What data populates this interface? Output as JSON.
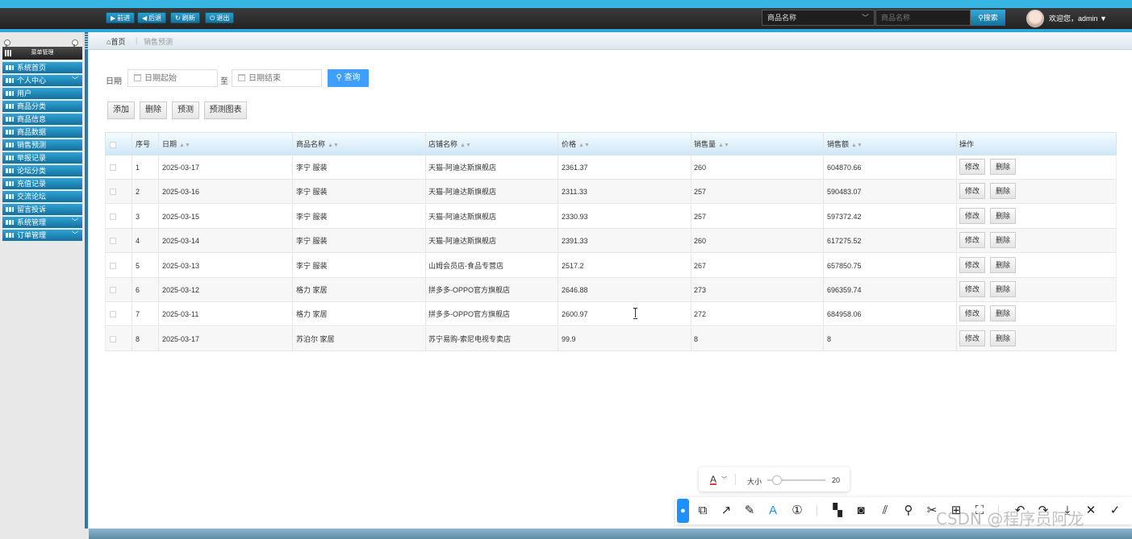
{
  "header": {
    "nav_buttons": [
      {
        "icon": "play-icon",
        "glyph": "▶",
        "label": "前进"
      },
      {
        "icon": "back-icon",
        "glyph": "◀",
        "label": "后退"
      },
      {
        "icon": "refresh-icon",
        "glyph": "↻",
        "label": "刷新"
      },
      {
        "icon": "power-icon",
        "glyph": "⏻",
        "label": "退出"
      }
    ],
    "search_field_select": "商品名称",
    "search_placeholder": "商品名称",
    "search_button": "搜索",
    "welcome": "欢迎您，admin"
  },
  "sidebar": {
    "title": "菜单管理",
    "items": [
      {
        "label": "系统首页",
        "expandable": false
      },
      {
        "label": "个人中心",
        "expandable": true
      },
      {
        "label": "用户",
        "expandable": false
      },
      {
        "label": "商品分类",
        "expandable": false
      },
      {
        "label": "商品信息",
        "expandable": false
      },
      {
        "label": "商品数据",
        "expandable": false
      },
      {
        "label": "销售预测",
        "expandable": false
      },
      {
        "label": "举报记录",
        "expandable": false
      },
      {
        "label": "论坛分类",
        "expandable": false
      },
      {
        "label": "充值记录",
        "expandable": false
      },
      {
        "label": "交流论坛",
        "expandable": false
      },
      {
        "label": "留言投诉",
        "expandable": false
      },
      {
        "label": "系统管理",
        "expandable": true
      },
      {
        "label": "订单管理",
        "expandable": true
      }
    ]
  },
  "breadcrumb": {
    "home": "首页",
    "current": "销售预测"
  },
  "filter": {
    "date_label": "日期",
    "start_placeholder": "日期起始",
    "to_label": "至",
    "end_placeholder": "日期结束",
    "query_button": "查询"
  },
  "actions": [
    "添加",
    "删除",
    "预测",
    "预测图表"
  ],
  "table": {
    "columns": [
      "序号",
      "日期",
      "商品名称",
      "店铺名称",
      "价格",
      "销售量",
      "销售额",
      "操作"
    ],
    "rows": [
      [
        "1",
        "2025-03-17",
        "李宁 服装",
        "天猫-阿迪达斯旗舰店",
        "2361.37",
        "260",
        "604870.66"
      ],
      [
        "2",
        "2025-03-16",
        "李宁 服装",
        "天猫-阿迪达斯旗舰店",
        "2311.33",
        "257",
        "590483.07"
      ],
      [
        "3",
        "2025-03-15",
        "李宁 服装",
        "天猫-阿迪达斯旗舰店",
        "2330.93",
        "257",
        "597372.42"
      ],
      [
        "4",
        "2025-03-14",
        "李宁 服装",
        "天猫-阿迪达斯旗舰店",
        "2391.33",
        "260",
        "617275.52"
      ],
      [
        "5",
        "2025-03-13",
        "李宁 服装",
        "山姆会员店-食品专营店",
        "2517.2",
        "267",
        "657850.75"
      ],
      [
        "6",
        "2025-03-12",
        "格力 家居",
        "拼多多-OPPO官方旗舰店",
        "2646.88",
        "273",
        "696359.74"
      ],
      [
        "7",
        "2025-03-11",
        "格力 家居",
        "拼多多-OPPO官方旗舰店",
        "2600.97",
        "272",
        "684958.06"
      ],
      [
        "8",
        "2025-03-17",
        "苏泊尔 家居",
        "苏宁易购-索尼电视专卖店",
        "99.9",
        "8",
        "8"
      ]
    ],
    "edit_label": "修改",
    "delete_label": "删除"
  },
  "screenshot_tool": {
    "size_label": "大小",
    "size_value": "20",
    "font_glyph": "A",
    "tools": [
      "balloon-icon",
      "shapes-icon",
      "arrow-icon",
      "pen-icon",
      "text-icon",
      "number-icon",
      "mosaic-icon",
      "blur-icon",
      "hatch-icon",
      "pin-icon",
      "scissors-icon",
      "ocr-icon",
      "scan-icon",
      "undo-icon",
      "redo-icon",
      "download-icon",
      "close-icon",
      "check-icon"
    ],
    "watermark": "CSDN @程序员阿龙"
  }
}
